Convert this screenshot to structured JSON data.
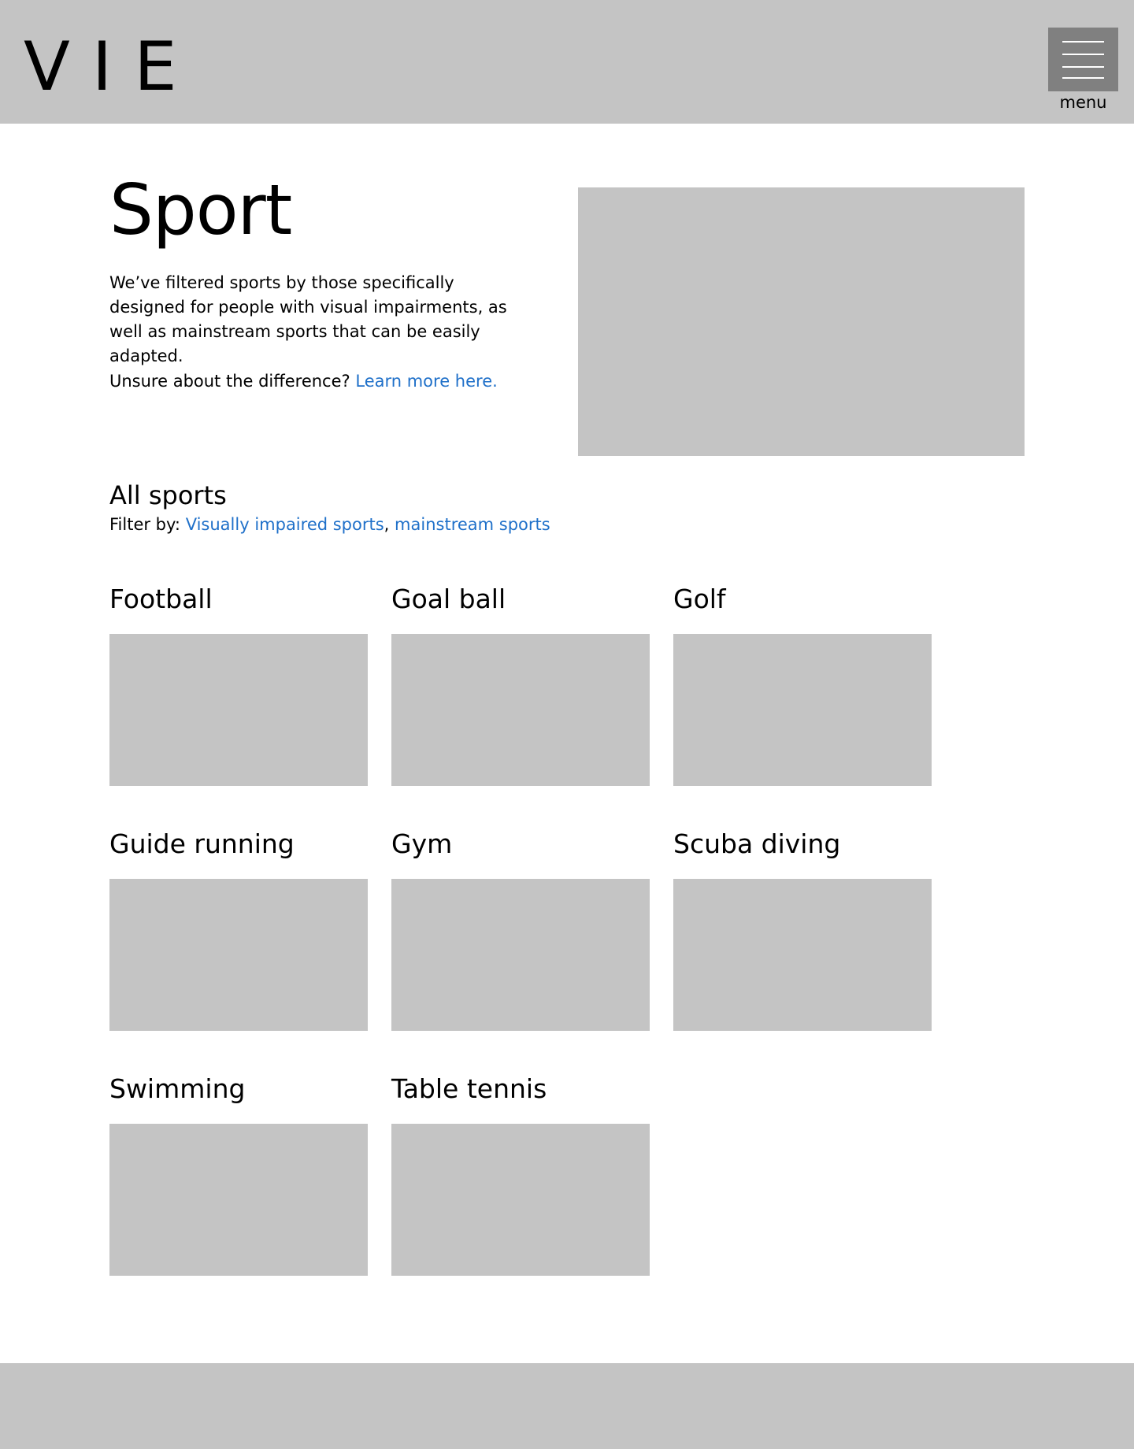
{
  "header": {
    "logo_text": "VIE",
    "menu_label": "menu"
  },
  "hero": {
    "title": "Sport",
    "description": "We’ve filtered sports by those specifically designed for people with visual impairments, as well as mainstream sports that can be easily adapted.",
    "note_text": "Unsure about the difference?",
    "note_link": "Learn more here."
  },
  "section": {
    "title": "All sports",
    "filter_label": "Filter by:",
    "filter_options": [
      "Visually impaired sports",
      "mainstream sports"
    ],
    "filter_separator": ","
  },
  "sports": [
    {
      "name": "Football"
    },
    {
      "name": "Goal ball"
    },
    {
      "name": "Golf"
    },
    {
      "name": "Guide running"
    },
    {
      "name": "Gym"
    },
    {
      "name": "Scuba diving"
    },
    {
      "name": "Swimming"
    },
    {
      "name": "Table tennis"
    }
  ],
  "colors": {
    "header_bg": "#c4c4c4",
    "menu_button_bg": "#808080",
    "placeholder": "#c4c4c4",
    "link": "#1f70c9",
    "text": "#000000"
  }
}
